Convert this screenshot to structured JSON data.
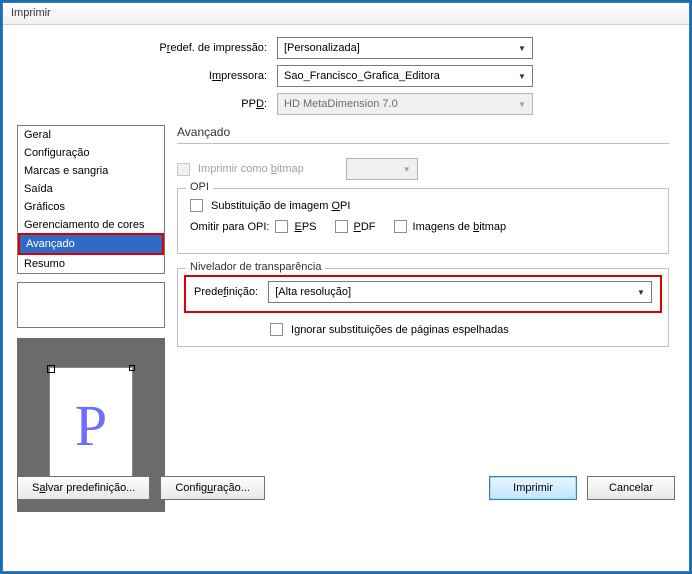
{
  "window": {
    "title": "Imprimir"
  },
  "topform": {
    "preset_label_pre": "P",
    "preset_label_u": "r",
    "preset_label_post": "edef. de impressão:",
    "preset_value": "[Personalizada]",
    "printer_label_pre": "I",
    "printer_label_u": "m",
    "printer_label_post": "pressora:",
    "printer_value": "Sao_Francisco_Grafica_Editora",
    "ppd_label_pre": "PP",
    "ppd_label_u": "D",
    "ppd_label_post": ":",
    "ppd_value": "HD MetaDimension 7.0"
  },
  "nav": {
    "items": [
      "Geral",
      "Configuração",
      "Marcas e sangria",
      "Saída",
      "Gráficos",
      "Gerenciamento de cores",
      "Avançado",
      "Resumo"
    ],
    "selected_index": 6
  },
  "section": {
    "title": "Avançado",
    "bitmap_pre": "Imprimir como ",
    "bitmap_u": "b",
    "bitmap_post": "itmap",
    "opi": {
      "legend": "OPI",
      "subst_pre": "Substituição de imagem ",
      "subst_u": "O",
      "subst_post": "PI",
      "omit_label": "Omitir para OPI:",
      "eps_u": "E",
      "eps_post": "PS",
      "pdf_u": "P",
      "pdf_post": "DF",
      "bmp_pre": "Imagens de ",
      "bmp_u": "b",
      "bmp_post": "itmap"
    },
    "flattener": {
      "legend": "Nivelador de transparência",
      "preset_label_pre": "Prede",
      "preset_label_u": "f",
      "preset_label_post": "inição:",
      "preset_value": "[Alta resolução]",
      "ignore_pre": "I",
      "ignore_u": "g",
      "ignore_post": "norar substituições de páginas espelhadas"
    }
  },
  "buttons": {
    "save_pre": "S",
    "save_u": "a",
    "save_post": "lvar predefinição...",
    "config_pre": "Config",
    "config_u": "u",
    "config_post": "ração...",
    "print": "Imprimir",
    "cancel": "Cancelar"
  },
  "preview": {
    "glyph": "P"
  }
}
